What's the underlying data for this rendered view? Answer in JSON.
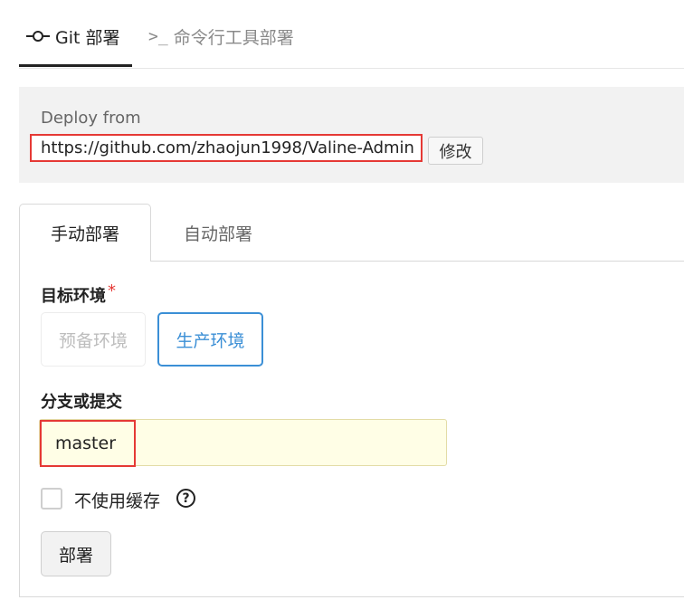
{
  "top_tabs": [
    {
      "icon": "git-commit-icon",
      "label": "Git 部署"
    },
    {
      "icon": "terminal-icon",
      "label": "命令行工具部署"
    }
  ],
  "deploy": {
    "label": "Deploy from",
    "url": "https://github.com/zhaojun1998/Valine-Admin",
    "modify_label": "修改"
  },
  "sub_tabs": [
    {
      "label": "手动部署"
    },
    {
      "label": "自动部署"
    }
  ],
  "form": {
    "env_label": "目标环境",
    "required_mark": "*",
    "env_options": [
      "预备环境",
      "生产环境"
    ],
    "branch_label": "分支或提交",
    "branch_value": "master",
    "no_cache_label": "不使用缓存",
    "help_symbol": "?",
    "deploy_button": "部署"
  },
  "colors": {
    "accent": "#3b8fd6",
    "highlight_border": "#e53935"
  }
}
